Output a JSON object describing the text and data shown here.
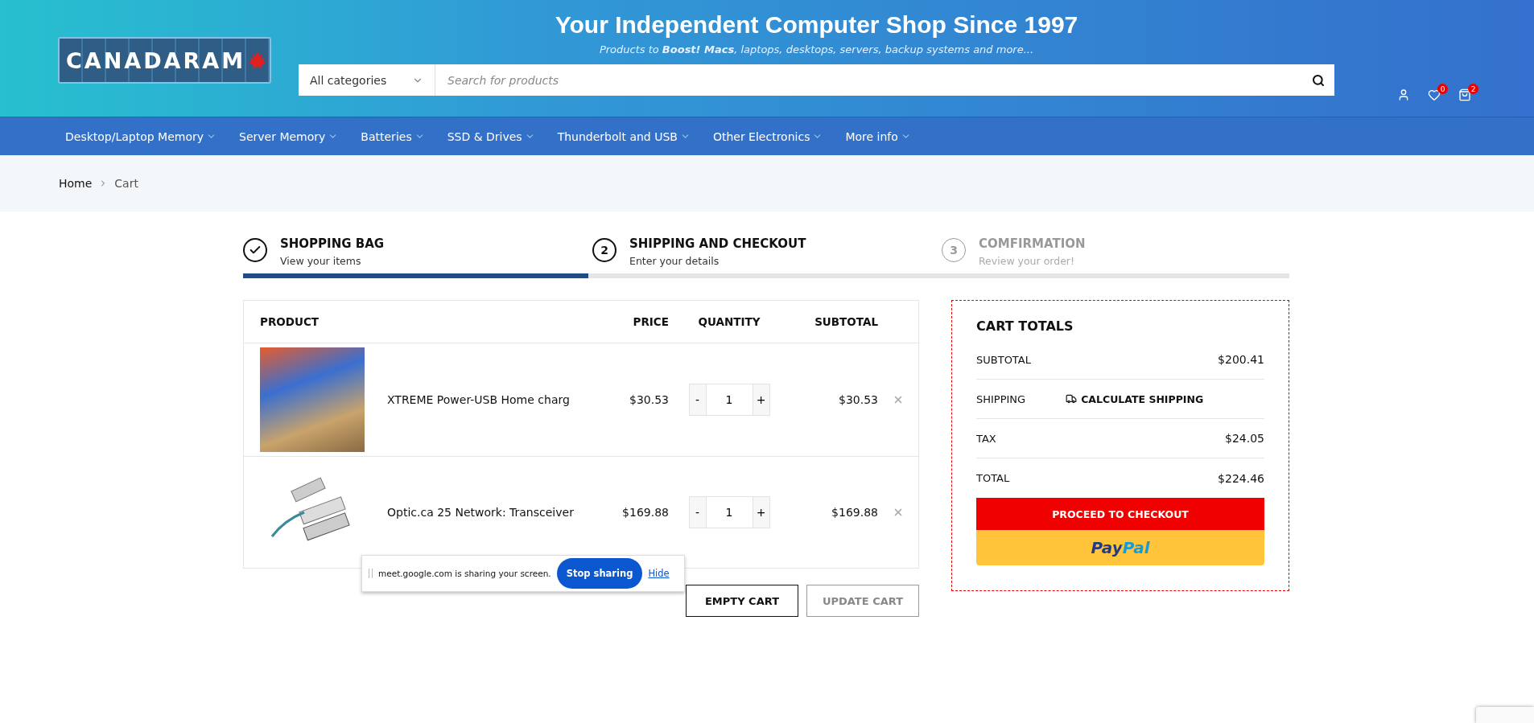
{
  "header": {
    "logo": "CANADARAM",
    "title": "Your Independent Computer Shop Since 1997",
    "tagline": "Products to **Boost! Macs**, laptops, desktops, servers, backup systems and more...",
    "category": "All categories",
    "search_placeholder": "Search for products",
    "wishlist_count": "0",
    "cart_count": "2"
  },
  "nav": [
    "Desktop/Laptop Memory",
    "Server Memory",
    "Batteries",
    "SSD & Drives",
    "Thunderbolt and USB",
    "Other Electronics",
    "More info"
  ],
  "breadcrumb": [
    "Home",
    "Cart"
  ],
  "steps": [
    {
      "completed": true,
      "active": true,
      "title": "SHOPPING BAG",
      "subtitle": "View your items"
    },
    {
      "completed": false,
      "active": true,
      "number": "2",
      "title": "SHIPPING AND CHECKOUT",
      "subtitle": "Enter your details"
    },
    {
      "completed": false,
      "active": false,
      "number": "3",
      "title": "COMFIRMATION",
      "subtitle": "Review your order!"
    }
  ],
  "progress": {
    "level": 0.33
  },
  "table": {
    "columns": [
      "PRODUCT",
      "PRICE",
      "QUANTITY",
      "SUBTOTAL"
    ],
    "rows": [
      {
        "kind": "charger",
        "name": "XTREME Power-USB Home charg",
        "price": "$30.53",
        "quantity": "1",
        "subtotal": "$30.53"
      },
      {
        "kind": "transceiver",
        "name": "Optic.ca 25 Network: Transceiver",
        "price": "$169.88",
        "quantity": "1",
        "subtotal": "$169.88"
      }
    ]
  },
  "qty_minus": "-",
  "qty_plus": "+",
  "actions": [
    {
      "label": "EMPTY CART",
      "disabled": false
    },
    {
      "label": "UPDATE CART",
      "disabled": true
    }
  ],
  "totals": {
    "title": "CART TOTALS",
    "rows": [
      {
        "kind": "amount",
        "label": "SUBTOTAL",
        "value": "$200.41"
      },
      {
        "kind": "shipping",
        "label": "SHIPPING",
        "value": "CALCULATE SHIPPING"
      },
      {
        "kind": "amount",
        "label": "TAX",
        "value": "$24.05"
      },
      {
        "kind": "amount",
        "label": "TOTAL",
        "value": "$224.46"
      }
    ],
    "checkout": "PROCEED TO CHECKOUT",
    "paypal": "PayPal"
  },
  "share_bar": {
    "message": "meet.google.com is sharing your screen.",
    "stop": "Stop sharing",
    "hide": "Hide"
  }
}
